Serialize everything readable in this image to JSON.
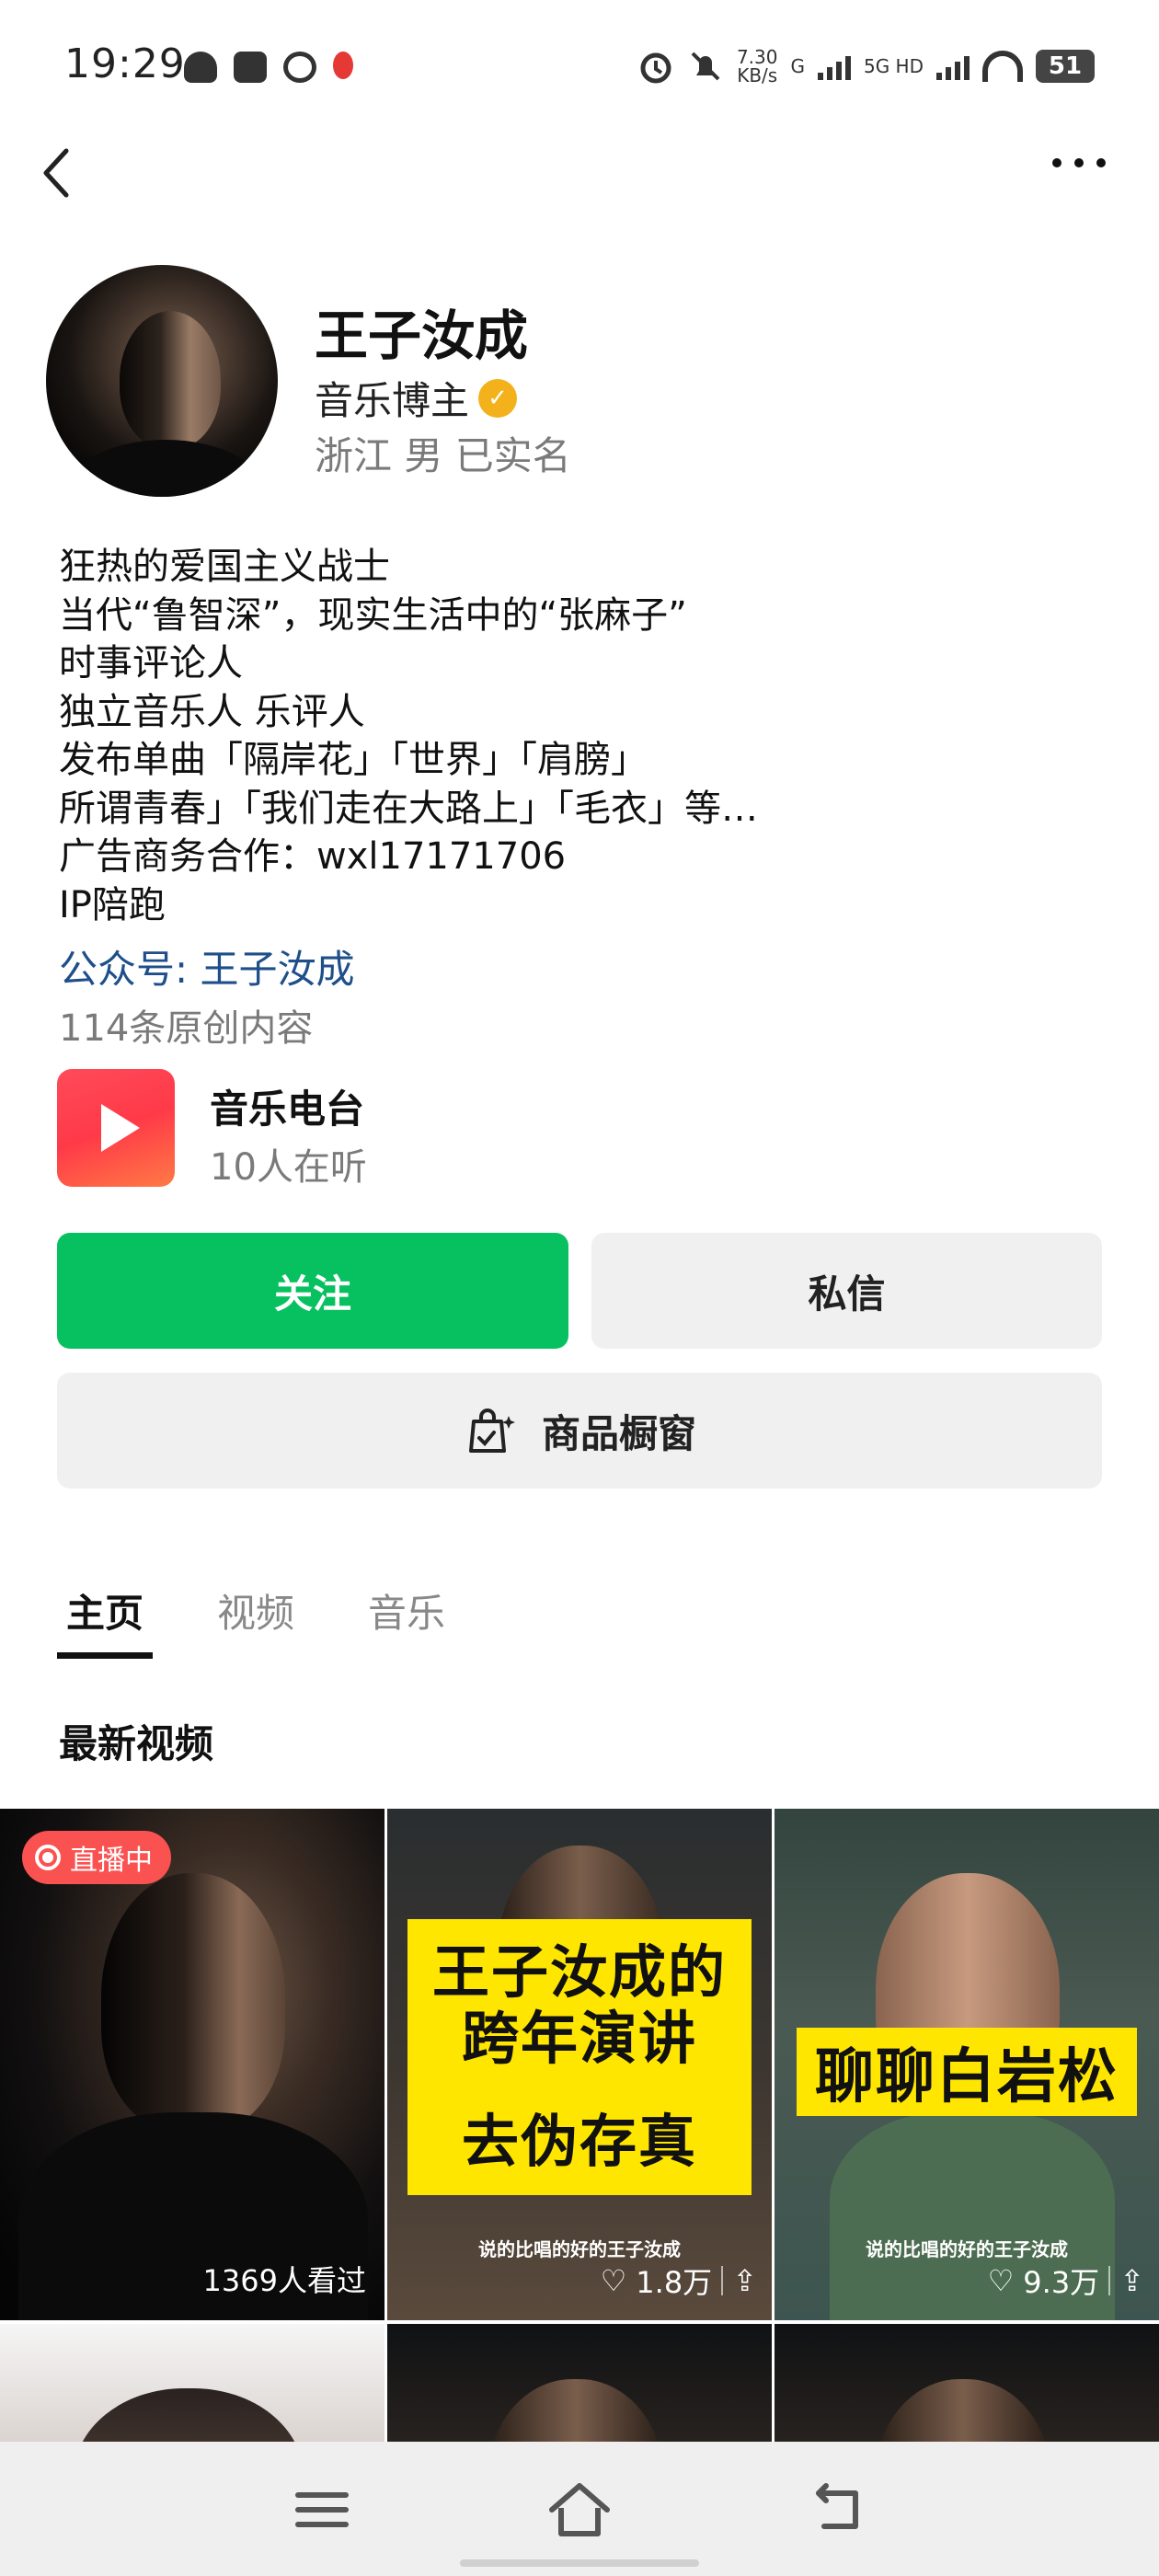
{
  "status_bar": {
    "time": "19:29",
    "net_speed_top": "7.30",
    "net_speed_bottom": "KB/s",
    "sim1": "G",
    "sim2": "5G HD",
    "battery": "51"
  },
  "profile": {
    "name": "王子汝成",
    "role": "音乐博主",
    "meta": "浙江 男 已实名",
    "bio": [
      "狂热的爱国主义战士",
      "当代“鲁智深”，现实生活中的“张麻子”",
      "时事评论人",
      "独立音乐人 乐评人",
      "发布单曲「隔岸花」「世界」「肩膀」",
      "所谓青春」「我们走在大路上」「毛衣」等…",
      "广告商务合作：wxl17171706",
      "IP陪跑"
    ],
    "link": "公众号: 王子汝成",
    "original_count": "114条原创内容"
  },
  "radio": {
    "title": "音乐电台",
    "listeners": "10人在听"
  },
  "buttons": {
    "follow": "关注",
    "message": "私信",
    "shop": "商品橱窗"
  },
  "tabs": [
    "主页",
    "视频",
    "音乐"
  ],
  "section_title": "最新视频",
  "videos": [
    {
      "badge": "直播中",
      "viewers": "1369人看过"
    },
    {
      "lines": [
        "王子汝成的",
        "跨年演讲",
        "去伪存真"
      ],
      "caption": "说的比唱的好的王子汝成",
      "likes": "1.8万"
    },
    {
      "headline": "聊聊白岩松",
      "caption": "说的比唱的好的王子汝成",
      "likes": "9.3万"
    }
  ],
  "colors": {
    "follow_green": "#07c160",
    "link_blue": "#1f4f8a",
    "live_red": "#fa5151",
    "verify_gold": "#f3b21b",
    "thumbnail_yellow": "#ffe600"
  }
}
